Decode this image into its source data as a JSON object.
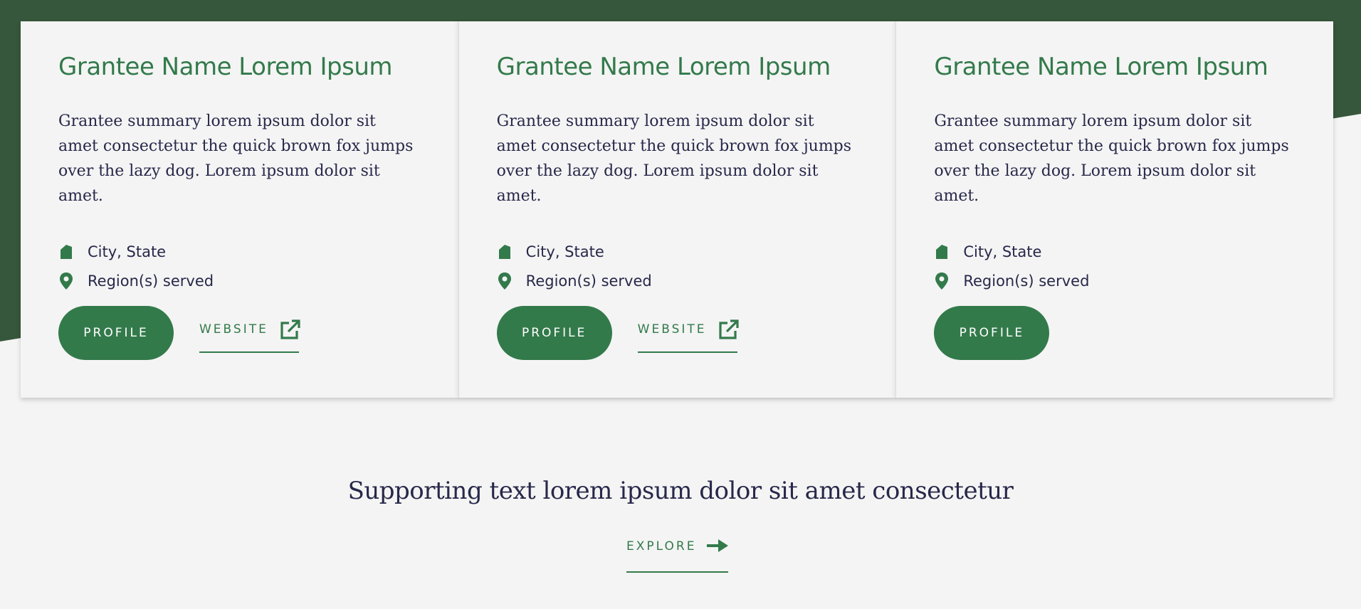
{
  "colors": {
    "brand_green": "#337a4b",
    "dark_green_band": "#36573b",
    "page_background": "#f4f4f4",
    "text_navy": "#27284a"
  },
  "cards": [
    {
      "title": "Grantee Name Lorem Ipsum",
      "summary": "Grantee summary lorem ipsum dolor sit amet consectetur the quick brown fox jumps over the lazy dog. Lorem ipsum dolor sit amet.",
      "location": "City, State",
      "region": "Region(s) served",
      "location_icon": "building-icon",
      "region_icon": "map-pin-icon",
      "profile_label": "PROFILE",
      "website_label": "WEBSITE",
      "website_icon": "external-link-icon"
    },
    {
      "title": "Grantee Name Lorem Ipsum",
      "summary": "Grantee summary lorem ipsum dolor sit amet consectetur the quick brown fox jumps over the lazy dog. Lorem ipsum dolor sit amet.",
      "location": "City, State",
      "region": "Region(s) served",
      "location_icon": "building-icon",
      "region_icon": "map-pin-icon",
      "profile_label": "PROFILE",
      "website_label": "WEBSITE",
      "website_icon": "external-link-icon"
    },
    {
      "title": "Grantee Name Lorem Ipsum",
      "summary": "Grantee summary lorem ipsum dolor sit amet consectetur the quick brown fox jumps over the lazy dog. Lorem ipsum dolor sit amet.",
      "location": "City, State",
      "region": "Region(s) served",
      "location_icon": "building-icon",
      "region_icon": "map-pin-icon",
      "profile_label": "PROFILE"
    }
  ],
  "supporting": {
    "text": "Supporting text lorem ipsum dolor sit amet consectetur",
    "explore_label": "EXPLORE",
    "explore_icon": "arrow-right-icon"
  }
}
